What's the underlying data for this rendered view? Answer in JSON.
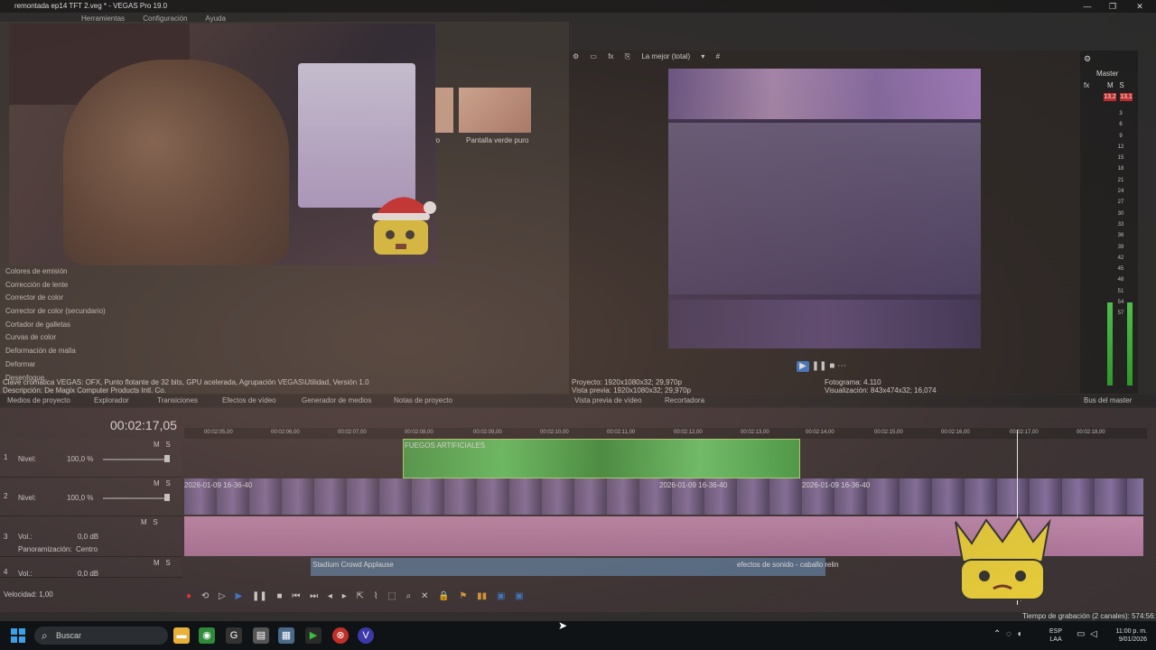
{
  "window": {
    "title": "remontada ep14 TFT 2.veg * - VEGAS Pro 19.0",
    "minimize": "—",
    "maximize": "❐",
    "close": "✕"
  },
  "menu": [
    "Herramientas",
    "Configuración",
    "Ayuda"
  ],
  "media_thumbs": {
    "label_left": "ro",
    "label_right": "Pantalla verde puro"
  },
  "fx_list": [
    "Colores de emisión",
    "Corrección de lente",
    "Corrector de color",
    "Corrector de color (secundario)",
    "Cortador de galletas",
    "Curvas de color",
    "Deformación de malla",
    "Deformar",
    "Desenfoque"
  ],
  "fx_info": {
    "line1": "Clave cromática VEGAS: OFX, Punto flotante de 32 bits, GPU acelerada, Agrupación VEGAS\\Utilidad, Versión 1.0",
    "line2": "Descripción: De Magix Computer Products Intl. Co."
  },
  "preview": {
    "quality": "La mejor (total)",
    "project_label": "Proyecto:",
    "project_value": "1920x1080x32; 29,970p",
    "preview_label": "Vista previa:",
    "preview_value": "1920x1080x32; 29,970p",
    "frame_label": "Fotograma:",
    "frame_value": "4.110",
    "display_label": "Visualización:",
    "display_value": "843x474x32; 16,074",
    "more": "⋯"
  },
  "master": {
    "label": "Master",
    "m": "M",
    "s": "S",
    "peak_l": "13,2",
    "peak_r": "13,1",
    "scale": [
      "3",
      "6",
      "9",
      "12",
      "15",
      "18",
      "21",
      "24",
      "27",
      "30",
      "33",
      "36",
      "39",
      "42",
      "45",
      "48",
      "51",
      "54",
      "57"
    ]
  },
  "tabs": {
    "media": "Medios de proyecto",
    "explorer": "Explorador",
    "transitions": "Transiciones",
    "video_fx": "Efectos de vídeo",
    "generators": "Generador de medios",
    "notes": "Notas de proyecto",
    "video_preview": "Vista previa de vídeo",
    "trimmer": "Recortadora",
    "master_bus": "Bus del master"
  },
  "timeline": {
    "timecode": "00:02:17,05",
    "ruler": [
      "00:02:05,00",
      "00:02:06,00",
      "00:02:07,00",
      "00:02:08,00",
      "00:02:09,00",
      "00:02:10,00",
      "00:02:11,00",
      "00:02:12,00",
      "00:02:13,00",
      "00:02:14,00",
      "00:02:15,00",
      "00:02:16,00",
      "00:02:17,00",
      "00:02:18,00"
    ],
    "tracks": [
      {
        "num": "1",
        "label": "Nivel:",
        "value": "100,0 %",
        "m": "M",
        "s": "S"
      },
      {
        "num": "2",
        "label": "Nivel:",
        "value": "100,0 %",
        "m": "M",
        "s": "S"
      },
      {
        "num": "3",
        "label": "Vol.:",
        "value": "0,0 dB",
        "pan_label": "Panoramización:",
        "pan_value": "Centro",
        "m": "M",
        "s": "S"
      },
      {
        "num": "4",
        "label": "Vol.:",
        "value": "0,0 dB",
        "m": "M",
        "s": "S"
      }
    ],
    "clip_fx": "FUEGOS ARTIFICIALES",
    "clip_video_titles": [
      "2026-01-09 16-36-40",
      "2026-01-09 16-36-40",
      "2026-01-09 16-36-40"
    ],
    "audio_clip_1": "Stadium Crowd Applause",
    "audio_clip_2": "efectos de sonido - caballo relin",
    "speed": "Velocidad: 1,00",
    "cursor_time": "00:02:17,05",
    "rec_time": "Tiempo de grabación (2 canales): 574:56:55"
  },
  "taskbar": {
    "search_placeholder": "Buscar",
    "lang_top": "ESP",
    "lang_bottom": "LAA",
    "time": "11:00 p. m.",
    "date": "9/01/2026"
  },
  "colors": {
    "accent": "#3a7fd6",
    "fx_clip": "#4aa84a",
    "audio_clip": "#c88fb4",
    "record": "#e33333"
  }
}
